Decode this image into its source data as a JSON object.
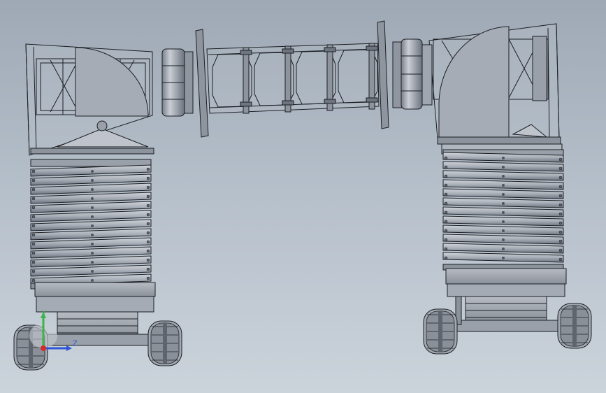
{
  "scene": {
    "background_top": "#9fa9b5",
    "background_bottom": "#cbd3db",
    "edge_color": "#1c1f24",
    "face_light": "#c3c8d0",
    "face_mid": "#a4aab4",
    "face_dark": "#7f8590",
    "axes": {
      "y_label": "Y",
      "z_label": "Z",
      "y_color": "#3bb54a",
      "z_color": "#2f55d6",
      "x_color": "#d42a2a"
    }
  }
}
